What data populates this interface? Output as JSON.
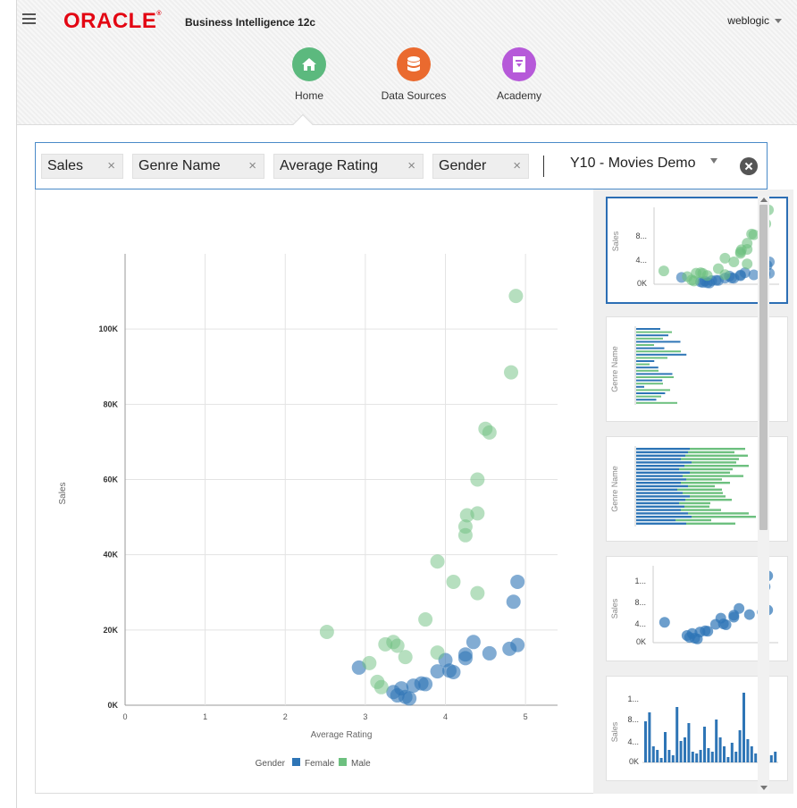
{
  "header": {
    "logo_text": "ORACLE",
    "logo_mark": "®",
    "product_name": "Business Intelligence 12c",
    "user_name": "weblogic"
  },
  "nav": [
    {
      "label": "Home",
      "icon": "home-icon",
      "color": "#5cb97e"
    },
    {
      "label": "Data Sources",
      "icon": "database-icon",
      "color": "#ea6a2f"
    },
    {
      "label": "Academy",
      "icon": "academy-icon",
      "color": "#b659d9"
    }
  ],
  "search": {
    "tokens": [
      "Sales",
      "Genre Name",
      "Average Rating",
      "Gender"
    ],
    "subject_area": "Y10 - Movies Demo"
  },
  "colors": {
    "female": "#2e75b6",
    "male": "#6dc07f",
    "accent": "#2c6eb4"
  },
  "chart_data": {
    "type": "scatter",
    "xlabel": "Average Rating",
    "ylabel": "Sales",
    "xlim": [
      0,
      5.4
    ],
    "ylim": [
      0,
      120000
    ],
    "x_ticks": [
      "0",
      "1",
      "2",
      "3",
      "4",
      "5"
    ],
    "y_ticks": [
      "0K",
      "20K",
      "40K",
      "60K",
      "80K",
      "100K"
    ],
    "legend": {
      "title": "Gender",
      "position": "bottom"
    },
    "series": [
      {
        "name": "Female",
        "points": [
          [
            2.92,
            10000
          ],
          [
            3.35,
            3500
          ],
          [
            3.4,
            2600
          ],
          [
            3.45,
            4500
          ],
          [
            3.5,
            2200
          ],
          [
            3.55,
            1800
          ],
          [
            3.6,
            5200
          ],
          [
            3.7,
            5800
          ],
          [
            3.75,
            5600
          ],
          [
            3.9,
            9000
          ],
          [
            4.0,
            12000
          ],
          [
            4.05,
            9200
          ],
          [
            4.1,
            8800
          ],
          [
            4.25,
            13500
          ],
          [
            4.25,
            12500
          ],
          [
            4.35,
            16800
          ],
          [
            4.55,
            13800
          ],
          [
            4.8,
            15000
          ],
          [
            4.85,
            27500
          ],
          [
            4.9,
            32800
          ],
          [
            4.9,
            16000
          ]
        ]
      },
      {
        "name": "Male",
        "points": [
          [
            2.52,
            19500
          ],
          [
            3.05,
            11200
          ],
          [
            3.15,
            6200
          ],
          [
            3.2,
            4800
          ],
          [
            3.25,
            16200
          ],
          [
            3.35,
            16800
          ],
          [
            3.4,
            15800
          ],
          [
            3.5,
            12800
          ],
          [
            3.75,
            22800
          ],
          [
            3.9,
            38200
          ],
          [
            3.9,
            14000
          ],
          [
            4.1,
            32800
          ],
          [
            4.25,
            45200
          ],
          [
            4.25,
            47500
          ],
          [
            4.27,
            50500
          ],
          [
            4.4,
            51000
          ],
          [
            4.4,
            60000
          ],
          [
            4.4,
            29800
          ],
          [
            4.5,
            73500
          ],
          [
            4.55,
            72500
          ],
          [
            4.82,
            88500
          ],
          [
            4.88,
            108800
          ]
        ]
      }
    ]
  },
  "thumbnails": {
    "t1": {
      "ylabel": "Sales",
      "ticks": [
        "8...",
        "4...",
        "0K"
      ]
    },
    "t2": {
      "ylabel": "Genre Name"
    },
    "t3": {
      "ylabel": "Genre Name"
    },
    "t4": {
      "ylabel": "Sales",
      "ticks": [
        "1...",
        "8...",
        "4...",
        "0K"
      ]
    },
    "t5": {
      "ylabel": "Sales",
      "ticks": [
        "1...",
        "8...",
        "4...",
        "0K"
      ]
    }
  }
}
